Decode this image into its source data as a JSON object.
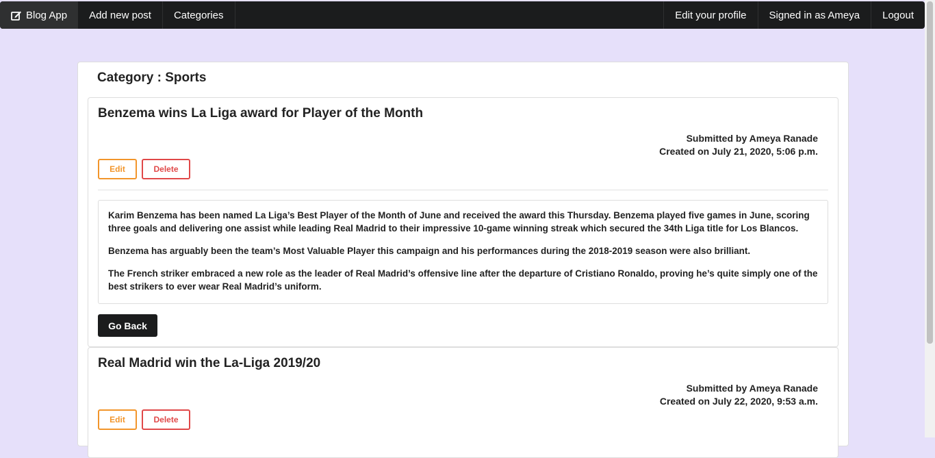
{
  "nav": {
    "brand": "Blog App",
    "add_post": "Add new post",
    "categories": "Categories",
    "edit_profile": "Edit your profile",
    "signed_in": "Signed in as Ameya",
    "logout": "Logout"
  },
  "category_title": "Category : Sports",
  "posts": [
    {
      "title": "Benzema wins La Liga award for Player of the Month",
      "submitted_by": "Submitted by Ameya Ranade",
      "created_on": "Created on July 21, 2020, 5:06 p.m.",
      "edit_label": "Edit",
      "delete_label": "Delete",
      "paragraphs": [
        "Karim Benzema has been named La Liga’s Best Player of the Month of June and received the award this Thursday. Benzema played five games in June, scoring three goals and delivering one assist while leading Real Madrid to their impressive 10-game winning streak which secured the 34th Liga title for Los Blancos.",
        "Benzema has arguably been the team’s Most Valuable Player this campaign and his performances during the 2018-2019 season were also brilliant.",
        "The French striker embraced a new role as the leader of Real Madrid’s offensive line after the departure of Cristiano Ronaldo, proving he’s quite simply one of the best strikers to ever wear Real Madrid’s uniform."
      ],
      "back_label": "Go Back"
    },
    {
      "title": "Real Madrid win the La-Liga 2019/20",
      "submitted_by": "Submitted by Ameya Ranade",
      "created_on": "Created on July 22, 2020, 9:53 a.m.",
      "edit_label": "Edit",
      "delete_label": "Delete"
    }
  ],
  "colors": {
    "navbar": "#1b1c1d",
    "background": "#e6e0fa",
    "edit": "#f2952a",
    "delete": "#e04848"
  }
}
